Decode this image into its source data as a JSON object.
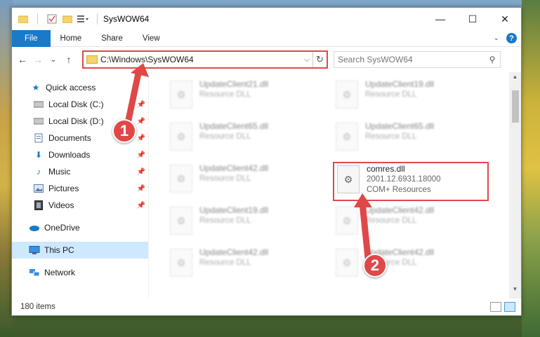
{
  "window": {
    "title": "SysWOW64",
    "controls": {
      "minimize": "—",
      "maximize": "☐",
      "close": "✕"
    }
  },
  "ribbon": {
    "tabs": [
      "File",
      "Home",
      "Share",
      "View"
    ]
  },
  "nav": {
    "back": "←",
    "forward": "→",
    "recent": "⌄",
    "up": "↑",
    "address": "C:\\Windows\\SysWOW64",
    "refresh": "↻",
    "search_placeholder": "Search SysWOW64"
  },
  "sidebar": {
    "items": [
      {
        "label": "Quick access",
        "icon": "star-icon"
      },
      {
        "label": "Local Disk (C:)",
        "icon": "drive-icon",
        "pinned": true
      },
      {
        "label": "Local Disk (D:)",
        "icon": "drive-icon",
        "pinned": true
      },
      {
        "label": "Documents",
        "icon": "documents-icon",
        "pinned": true
      },
      {
        "label": "Downloads",
        "icon": "download-icon",
        "pinned": true
      },
      {
        "label": "Music",
        "icon": "music-icon",
        "pinned": true
      },
      {
        "label": "Pictures",
        "icon": "pictures-icon",
        "pinned": true
      },
      {
        "label": "Videos",
        "icon": "videos-icon",
        "pinned": true
      },
      {
        "label": "OneDrive",
        "icon": "cloud-icon"
      },
      {
        "label": "This PC",
        "icon": "computer-icon"
      },
      {
        "label": "Network",
        "icon": "network-icon"
      }
    ]
  },
  "files": {
    "left": [
      {
        "name": "UpdateClient21.dll",
        "type": "Resource DLL"
      },
      {
        "name": "UpdateClient65.dll",
        "type": "Resource DLL"
      },
      {
        "name": "UpdateClient42.dll",
        "type": "Resource DLL"
      },
      {
        "name": "UpdateClient19.dll",
        "type": "Resource DLL"
      },
      {
        "name": "UpdateClient42.dll",
        "type": "Resource DLL"
      }
    ],
    "right": [
      {
        "name": "UpdateClient19.dll",
        "type": "Resource DLL"
      },
      {
        "name": "UpdateClient65.dll",
        "type": "Resource DLL"
      },
      {
        "name": "comres.dll",
        "version": "2001.12.6931.18000",
        "type": "COM+ Resources"
      },
      {
        "name": "UpdateClient42.dll",
        "type": "Resource DLL"
      },
      {
        "name": "UpdateClient42.dll",
        "type": "Resource DLL"
      }
    ]
  },
  "status": {
    "count": "180 items"
  },
  "callouts": {
    "one": "1",
    "two": "2"
  },
  "colors": {
    "highlight": "#e04848",
    "accent": "#1979ca"
  }
}
